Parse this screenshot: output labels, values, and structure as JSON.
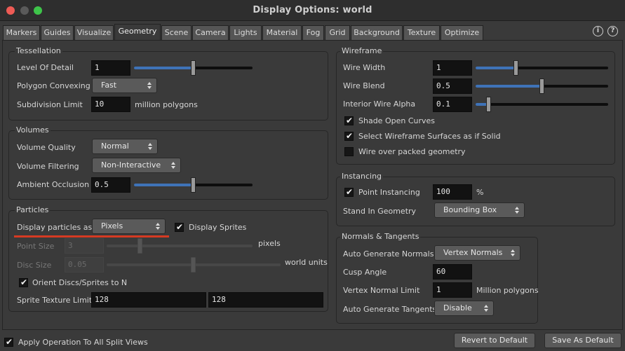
{
  "window": {
    "title": "Display Options:  world",
    "traffic_colors": [
      "#ee5b55",
      "#5a5a5a",
      "#3ec44a"
    ]
  },
  "tabs": [
    "Markers",
    "Guides",
    "Visualize",
    "Geometry",
    "Scene",
    "Camera",
    "Lights",
    "Material",
    "Fog",
    "Grid",
    "Background",
    "Texture",
    "Optimize"
  ],
  "active_tab": "Geometry",
  "help_icons": [
    "i",
    "?"
  ],
  "tessellation": {
    "title": "Tessellation",
    "lod_label": "Level Of Detail",
    "lod_value": "1",
    "lod_slider": 0.5,
    "convex_label": "Polygon Convexing",
    "convex_value": "Fast",
    "subdiv_label": "Subdivision Limit",
    "subdiv_value": "10",
    "subdiv_unit": "million polygons"
  },
  "volumes": {
    "title": "Volumes",
    "quality_label": "Volume Quality",
    "quality_value": "Normal",
    "filter_label": "Volume Filtering",
    "filter_value": "Non-Interactive",
    "ao_label": "Ambient Occlusion",
    "ao_value": "0.5",
    "ao_slider": 0.5
  },
  "particles": {
    "title": "Particles",
    "display_label": "Display particles as",
    "display_value": "Pixels",
    "sprites_label": "Display Sprites",
    "sprites_checked": true,
    "point_size_label": "Point Size",
    "point_size_value": "3",
    "point_size_unit": "pixels",
    "disc_size_label": "Disc Size",
    "disc_size_value": "0.05",
    "disc_size_unit": "world units",
    "orient_label": "Orient Discs/Sprites to N",
    "orient_checked": true,
    "sprite_limit_label": "Sprite Texture Limit",
    "sprite_limit_x": "128",
    "sprite_limit_y": "128",
    "highlight_color": "#d63a22"
  },
  "wireframe": {
    "title": "Wireframe",
    "width_label": "Wire Width",
    "width_value": "1",
    "width_slider": 0.3,
    "blend_label": "Wire Blend",
    "blend_value": "0.5",
    "blend_slider": 0.5,
    "alpha_label": "Interior Wire Alpha",
    "alpha_value": "0.1",
    "alpha_slider": 0.1,
    "shade_label": "Shade Open Curves",
    "shade_checked": true,
    "select_label": "Select Wireframe Surfaces as if Solid",
    "select_checked": true,
    "packed_label": "Wire over packed geometry",
    "packed_checked": false
  },
  "instancing": {
    "title": "Instancing",
    "point_label": "Point Instancing",
    "point_checked": true,
    "point_value": "100",
    "point_unit": "%",
    "standin_label": "Stand In Geometry",
    "standin_value": "Bounding Box"
  },
  "normals": {
    "title": "Normals & Tangents",
    "auto_normals_label": "Auto Generate Normals",
    "auto_normals_value": "Vertex Normals",
    "cusp_label": "Cusp Angle",
    "cusp_value": "60",
    "vnl_label": "Vertex Normal Limit",
    "vnl_value": "1",
    "vnl_unit": "Million polygons",
    "tangents_label": "Auto Generate Tangents",
    "tangents_value": "Disable"
  },
  "footer": {
    "apply_label": "Apply Operation To All Split Views",
    "apply_checked": true,
    "revert_label": "Revert to Default",
    "save_label": "Save As Default"
  },
  "accent_color": "#3f73b8"
}
